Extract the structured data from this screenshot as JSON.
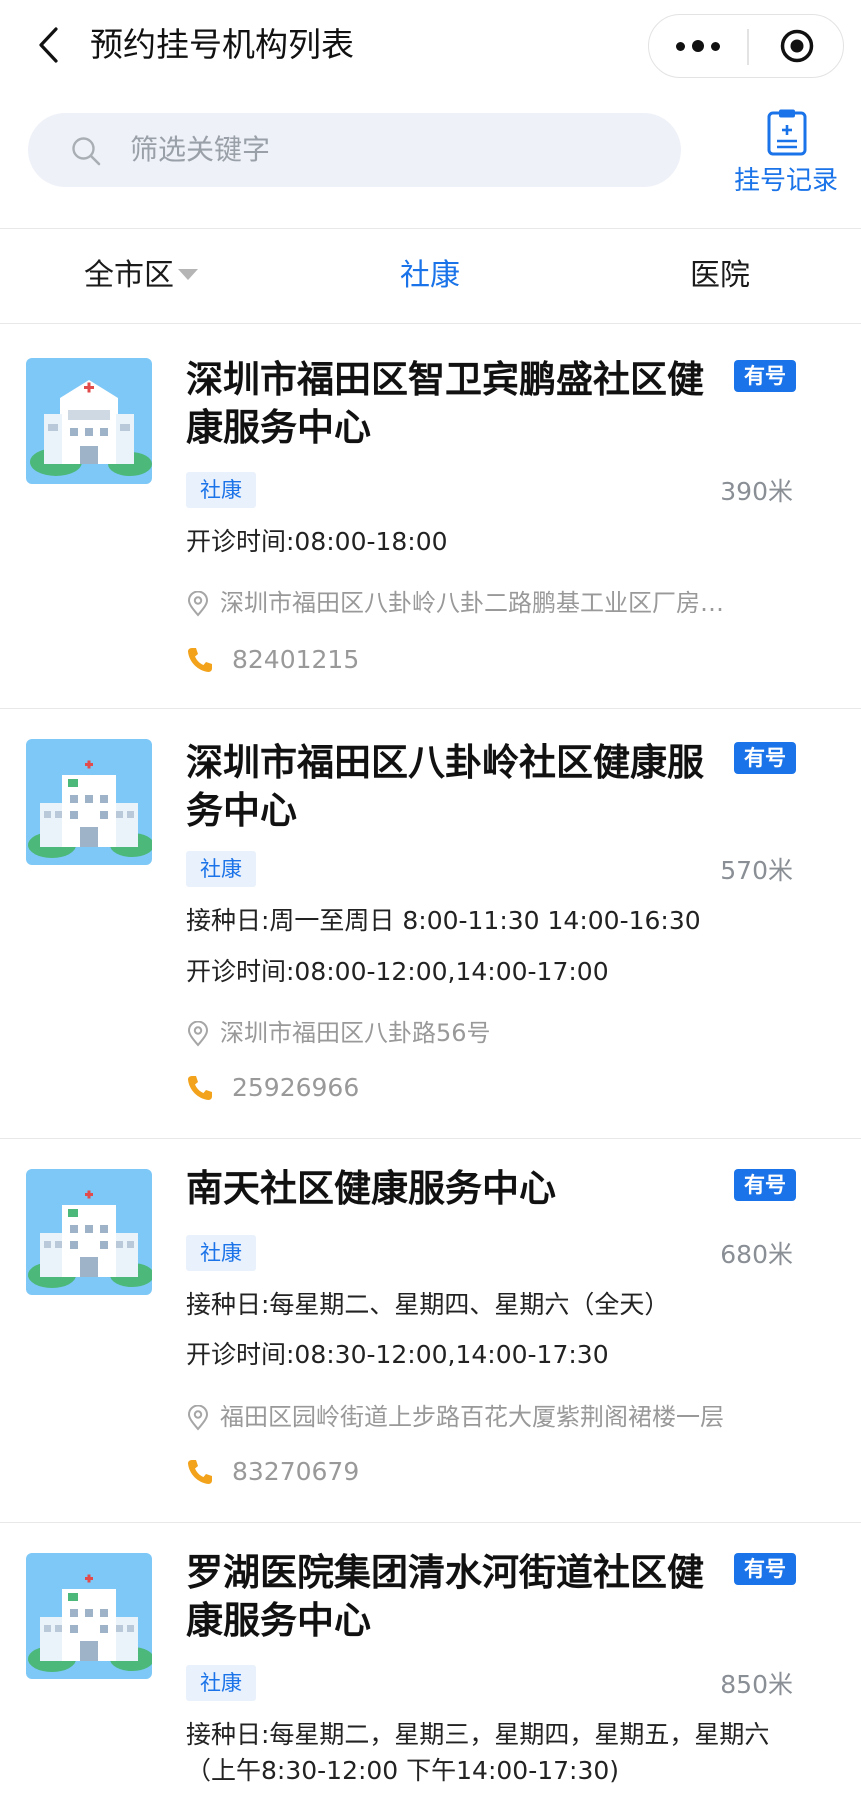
{
  "nav": {
    "title": "预约挂号机构列表"
  },
  "search": {
    "placeholder": "筛选关键字"
  },
  "records": {
    "label": "挂号记录"
  },
  "tabs": [
    {
      "label": "全市区"
    },
    {
      "label": "社康"
    },
    {
      "label": "医院"
    }
  ],
  "colors": {
    "accent": "#1a73e8",
    "phone": "#f2a31b",
    "thumb_bg": "#7ec8f7"
  },
  "institutions": [
    {
      "name": "深圳市福田区智卫宾鹏盛社区健康服务中心",
      "badge": "有号",
      "tag": "社康",
      "distance": "390米",
      "vaccination": "",
      "hours": "开诊时间:08:00-18:00",
      "address": "深圳市福田区八卦岭八卦二路鹏基工业区厂房…",
      "phone": "82401215"
    },
    {
      "name": "深圳市福田区八卦岭社区健康服务中心",
      "badge": "有号",
      "tag": "社康",
      "distance": "570米",
      "vaccination": "接种日:周一至周日 8:00-11:30 14:00-16:30",
      "hours": "开诊时间:08:00-12:00,14:00-17:00",
      "address": "深圳市福田区八卦路56号",
      "phone": "25926966"
    },
    {
      "name": "南天社区健康服务中心",
      "badge": "有号",
      "tag": "社康",
      "distance": "680米",
      "vaccination": "接种日:每星期二、星期四、星期六（全天）",
      "hours": "开诊时间:08:30-12:00,14:00-17:30",
      "address": "福田区园岭街道上步路百花大厦紫荆阁裙楼一层",
      "phone": "83270679"
    },
    {
      "name": "罗湖医院集团清水河街道社区健康服务中心",
      "badge": "有号",
      "tag": "社康",
      "distance": "850米",
      "vaccination": "接种日:每星期二，星期三，星期四，星期五，星期六（上午8:30-12:00 下午14:00-17:30)",
      "hours": "",
      "address": "",
      "phone": ""
    }
  ]
}
